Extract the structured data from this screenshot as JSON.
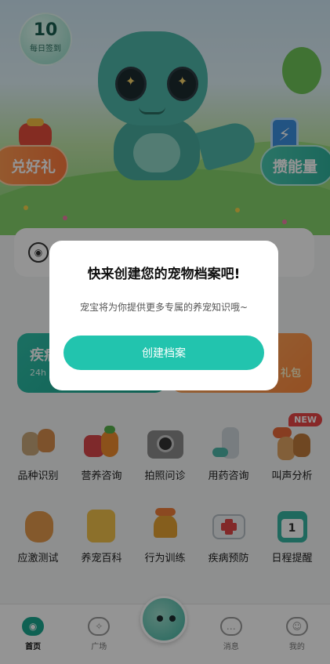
{
  "hero": {
    "sign_count": "10",
    "sign_label": "每日签到",
    "left_button": "兑好礼",
    "right_button": "攒能量"
  },
  "banners": {
    "left_title": "疾病",
    "left_sub": "24h",
    "right_tag": "礼包"
  },
  "grid": {
    "row1": [
      "品种识别",
      "营养咨询",
      "拍照问诊",
      "用药咨询",
      "叫声分析"
    ],
    "row2": [
      "应激测试",
      "养宠百科",
      "行为训练",
      "疾病预防",
      "日程提醒"
    ],
    "new_badge": "NEW"
  },
  "tabbar": {
    "home": "首页",
    "square": "广场",
    "messages": "消息",
    "mine": "我的"
  },
  "modal": {
    "title": "快来创建您的宠物档案吧!",
    "message": "宠宝将为你提供更多专属的养宠知识哦~",
    "button": "创建档案"
  },
  "colors": {
    "accent": "#22c4ae",
    "overlay": "rgba(0,0,0,0.42)"
  }
}
